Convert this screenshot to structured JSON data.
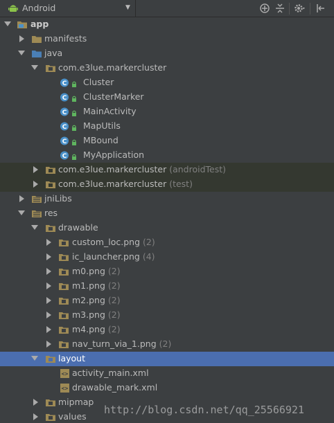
{
  "toolbar": {
    "view_mode": "Android",
    "icons": [
      "sync-icon",
      "collapse-all-icon",
      "settings-icon",
      "hide-panel-icon"
    ]
  },
  "tree": {
    "app": {
      "label": "app"
    },
    "manifests": {
      "label": "manifests"
    },
    "java": {
      "label": "java"
    },
    "pkg_main": {
      "label": "com.e3lue.markercluster"
    },
    "classes": [
      {
        "label": "Cluster"
      },
      {
        "label": "ClusterMarker"
      },
      {
        "label": "MainActivity"
      },
      {
        "label": "MapUtils"
      },
      {
        "label": "MBound"
      },
      {
        "label": "MyApplication"
      }
    ],
    "pkg_android_test": {
      "label": "com.e3lue.markercluster",
      "suffix": "(androidTest)"
    },
    "pkg_test": {
      "label": "com.e3lue.markercluster",
      "suffix": "(test)"
    },
    "jniLibs": {
      "label": "jniLibs"
    },
    "res": {
      "label": "res"
    },
    "drawable": {
      "label": "drawable"
    },
    "drawables": [
      {
        "label": "custom_loc.png",
        "count": "(2)"
      },
      {
        "label": "ic_launcher.png",
        "count": "(4)"
      },
      {
        "label": "m0.png",
        "count": "(2)"
      },
      {
        "label": "m1.png",
        "count": "(2)"
      },
      {
        "label": "m2.png",
        "count": "(2)"
      },
      {
        "label": "m3.png",
        "count": "(2)"
      },
      {
        "label": "m4.png",
        "count": "(2)"
      },
      {
        "label": "nav_turn_via_1.png",
        "count": "(2)"
      }
    ],
    "layout": {
      "label": "layout"
    },
    "layouts": [
      {
        "label": "activity_main.xml"
      },
      {
        "label": "drawable_mark.xml"
      }
    ],
    "mipmap": {
      "label": "mipmap"
    },
    "values": {
      "label": "values"
    }
  },
  "watermark": "http://blog.csdn.net/qq_25566921",
  "colors": {
    "background": "#3c3f41",
    "selection": "#4b6eaf",
    "test_background": "#343830",
    "folder": "#9e8a55",
    "class_icon": "#4a90c8",
    "lock": "#5fb55f"
  }
}
